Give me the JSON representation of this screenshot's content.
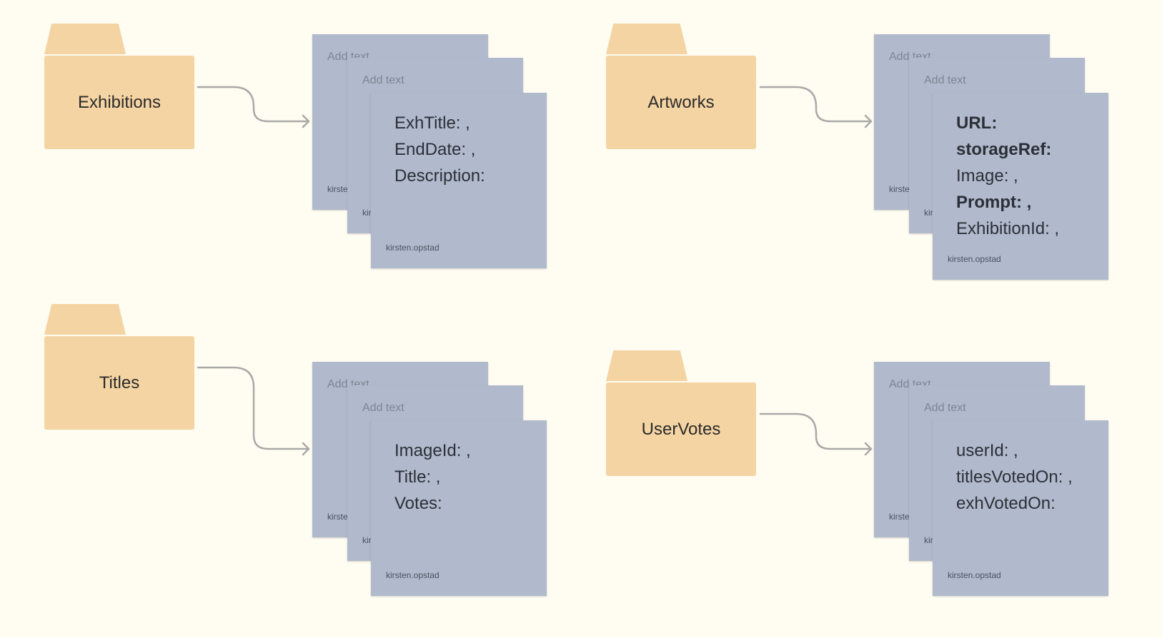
{
  "colors": {
    "background": "#fffcf1",
    "folder": "#f5d4a3",
    "note": "#b0bacc",
    "arrow": "#a9a9a9"
  },
  "groups": [
    {
      "folder_label": "Exhibitions",
      "note_placeholder": "Add text",
      "author": "kirsten.opstad",
      "fields": [
        {
          "text": "ExhTitle: ,",
          "bold": false
        },
        {
          "text": "EndDate: ,",
          "bold": false
        },
        {
          "text": "Description:",
          "bold": false
        }
      ]
    },
    {
      "folder_label": "Artworks",
      "note_placeholder": "Add text",
      "author": "kirsten.opstad",
      "fields": [
        {
          "text": "URL:",
          "bold": true
        },
        {
          "text": "storageRef:",
          "bold": true
        },
        {
          "text": "Image: ,",
          "bold": false
        },
        {
          "text": "Prompt: ,",
          "bold": true
        },
        {
          "text": "ExhibitionId: ,",
          "bold": false
        }
      ]
    },
    {
      "folder_label": "Titles",
      "note_placeholder": "Add text",
      "author": "kirsten.opstad",
      "fields": [
        {
          "text": "ImageId: ,",
          "bold": false
        },
        {
          "text": "Title: ,",
          "bold": false
        },
        {
          "text": "Votes:",
          "bold": false
        }
      ]
    },
    {
      "folder_label": "UserVotes",
      "note_placeholder": "Add text",
      "author": "kirsten.opstad",
      "fields": [
        {
          "text": "userId: ,",
          "bold": false
        },
        {
          "text": "titlesVotedOn: ,",
          "bold": false
        },
        {
          "text": "exhVotedOn:",
          "bold": false
        }
      ]
    }
  ]
}
